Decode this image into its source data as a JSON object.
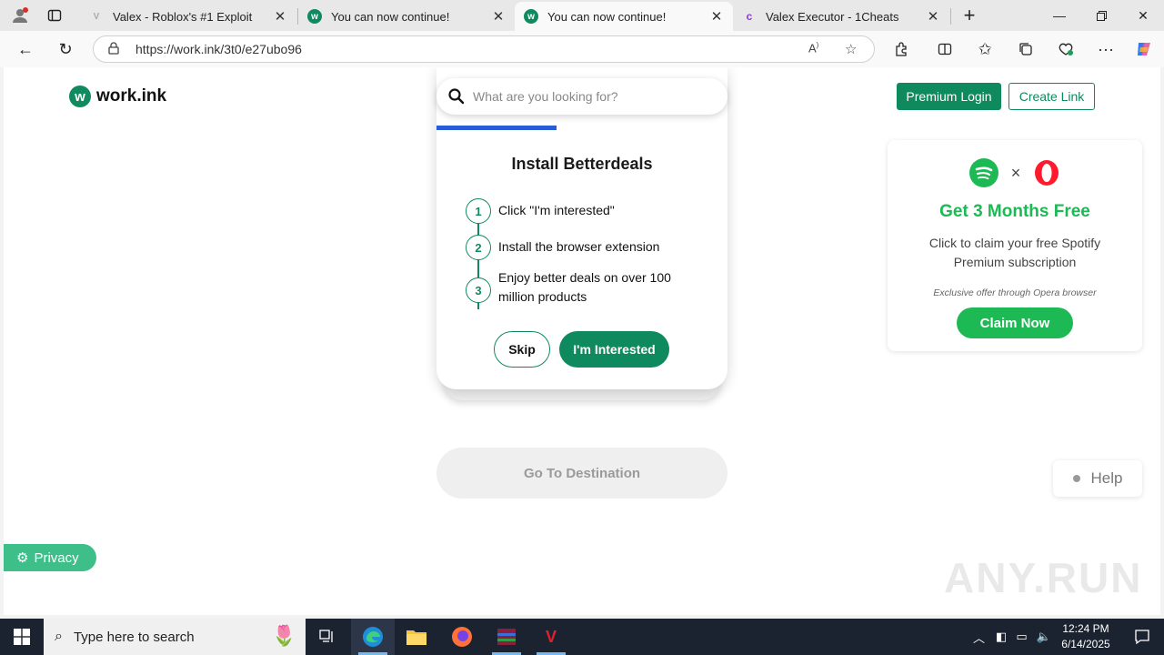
{
  "browser": {
    "tabs": [
      {
        "title": "Valex - Roblox's #1 Exploit",
        "favicon": "valex-icon"
      },
      {
        "title": "You can now continue!",
        "favicon": "workink-icon"
      },
      {
        "title": "You can now continue!",
        "favicon": "workink-icon",
        "active": true
      },
      {
        "title": "Valex Executor - 1Cheats",
        "favicon": "1cheats-icon"
      }
    ],
    "url": "https://work.ink/3t0/e27ubo96"
  },
  "page": {
    "logo_text": "work.ink",
    "search_placeholder": "What are you looking for?",
    "premium_login": "Premium Login",
    "create_link": "Create Link",
    "offer": {
      "heading": "Install Betterdeals",
      "steps": [
        {
          "num": "1",
          "text": "Click \"I'm interested\""
        },
        {
          "num": "2",
          "text": "Install the browser extension"
        },
        {
          "num": "3",
          "text": "Enjoy better deals on over 100 million products"
        }
      ],
      "skip": "Skip",
      "interested": "I'm Interested"
    },
    "go_destination": "Go To Destination",
    "ad": {
      "times": "×",
      "headline": "Get 3 Months Free",
      "description": "Click to claim your free Spotify Premium subscription",
      "fine_print": "Exclusive offer through Opera browser",
      "cta": "Claim Now"
    },
    "help": "Help",
    "privacy": "Privacy",
    "watermark": "ANY.RUN"
  },
  "taskbar": {
    "search_placeholder": "Type here to search",
    "time": "12:24 PM",
    "date": "6/14/2025"
  },
  "colors": {
    "brand_green": "#0f8a5f",
    "spotify_green": "#1db954",
    "progress_blue": "#2a5bd7",
    "privacy_green": "#3ebf8a"
  }
}
